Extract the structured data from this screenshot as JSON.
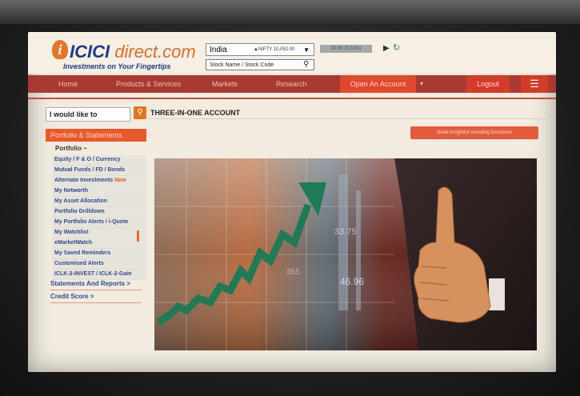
{
  "header": {
    "logo_brand": "ICICI",
    "logo_brand2": "direct.com",
    "logo_tagline": "Investments on Your Fingertips",
    "country_select": "India",
    "ticker_text": "▲NIFTY 10,052.00",
    "ticker_change": "30.50 (0.31%)",
    "search_placeholder": "Stock Name / Stock Code"
  },
  "nav": {
    "items": [
      "Home",
      "Products & Services",
      "Markets",
      "Research"
    ],
    "open_account": "Open An Account",
    "logout": "Logout"
  },
  "sidebar": {
    "i_would_like": "I would like to",
    "section_header": "Portfolio & Statements",
    "sub_header": "Portfolio ~",
    "items": [
      "Equity / F & O / Currency",
      "Mutual Funds / FD / Bonds",
      "Alternate Investments",
      "My Networth",
      "My Asset Allocation",
      "Portfolio Drilldown",
      "My Portfolio Alerts / i-Quote",
      "My Watchlist",
      "eMarketWatch",
      "My Saved Reminders",
      "Customised Alerts",
      "ICLK-2-INVEST / ICLK-2-Gain"
    ],
    "new_badge": "New",
    "statements": "Statements And Reports >",
    "credit_score": "Credit Score >"
  },
  "main": {
    "title": "THREE-IN-ONE ACCOUNT",
    "button": "Need Insightful Investing Decisions"
  },
  "hero": {
    "numbers": [
      "33.75",
      "355",
      "46.96"
    ]
  },
  "colors": {
    "accent": "#e9582d",
    "nav_bg": "#a83a33",
    "brand_blue": "#1e3b85",
    "arrow_green": "#1f7a55"
  }
}
